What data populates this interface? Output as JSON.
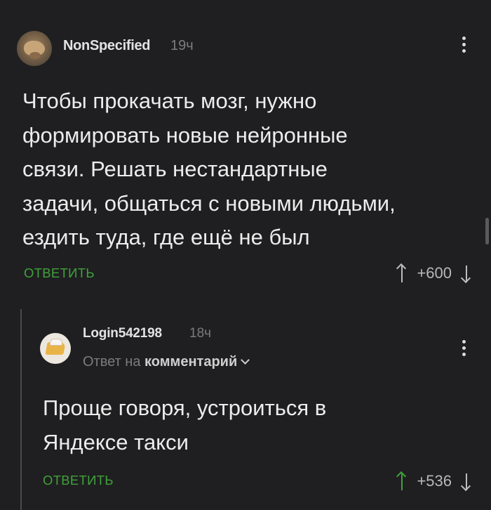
{
  "comments": [
    {
      "username": "NonSpecified",
      "time": "19ч",
      "text_lines": [
        "Чтобы прокачать мозг, нужно",
        "формировать новые нейронные",
        "связи. Решать нестандартные",
        "задачи, общаться с новыми людьми,",
        "ездить туда, где ещё не был"
      ],
      "reply_label": "ОТВЕТИТЬ",
      "score": "+600",
      "avatar_icon": "dog-avatar-icon"
    },
    {
      "username": "Login542198",
      "time": "18ч",
      "reply_to_prefix": "Ответ на",
      "reply_to_target": "комментарий",
      "text_lines": [
        "Проще говоря, устроиться в",
        "Яндексе такси"
      ],
      "reply_label": "ОТВЕТИТЬ",
      "score": "+536",
      "avatar_icon": "cheese-avatar-icon",
      "upvoted": true
    }
  ],
  "colors": {
    "background": "#1f1f21",
    "accent_green": "#3fa23a",
    "text": "#ececec",
    "muted": "#7c7c7c"
  }
}
